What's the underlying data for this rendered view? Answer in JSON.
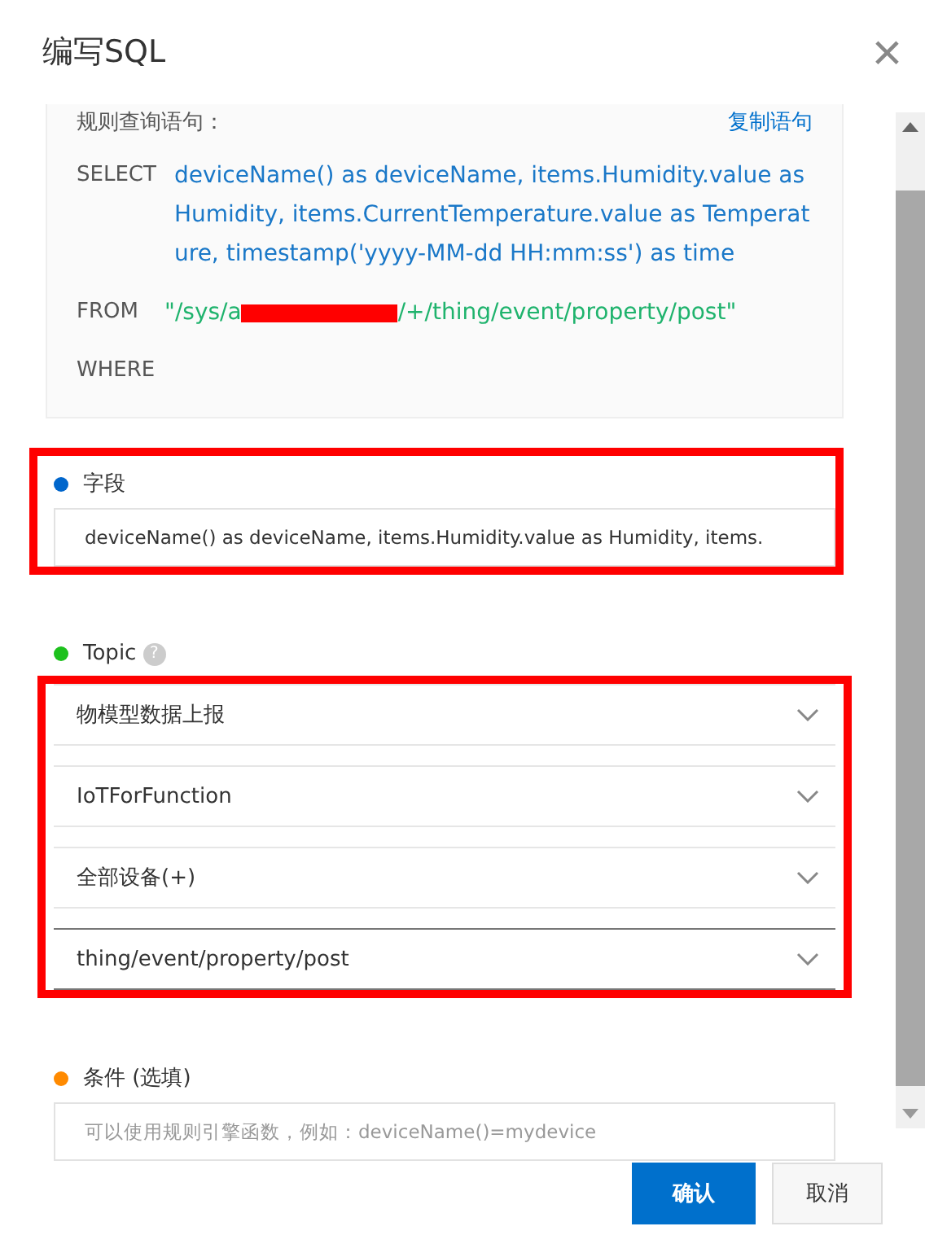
{
  "dialog": {
    "title": "编写SQL",
    "close": "×"
  },
  "sql_preview": {
    "label": "规则查询语句：",
    "copy_link": "复制语句",
    "clauses": [
      {
        "keyword": "SELECT",
        "kind": "expression",
        "parts": [
          "deviceName() as deviceName, items.Humidity.value as Humidity, items.CurrentTemperature.value as Temperature, timestamp('yyyy-MM-dd HH:mm:ss') as time"
        ]
      },
      {
        "keyword": "FROM",
        "kind": "topic",
        "parts": [
          "\"/sys/a",
          "/+/thing/event/property/post\""
        ],
        "redacted": true
      },
      {
        "keyword": "WHERE"
      }
    ]
  },
  "sections": [
    {
      "label": "字段",
      "color": "#0066cc",
      "kind": "input",
      "highlighted": true,
      "value": "deviceName() as deviceName, items.Humidity.value as Humidity, items."
    },
    {
      "label": "Topic",
      "color": "#1dc11d",
      "kind": "selects",
      "help": "?",
      "highlighted": true,
      "selects": [
        "物模型数据上报",
        "IoTForFunction",
        "全部设备(+)",
        "thing/event/property/post"
      ]
    },
    {
      "label": "条件 (选填)",
      "color": "#ff8a00",
      "kind": "input",
      "placeholder": "可以使用规则引擎函数，例如：deviceName()=mydevice"
    }
  ],
  "buttons": [
    {
      "label": "确认",
      "kind": "primary"
    },
    {
      "label": "取消",
      "kind": "secondary"
    }
  ]
}
